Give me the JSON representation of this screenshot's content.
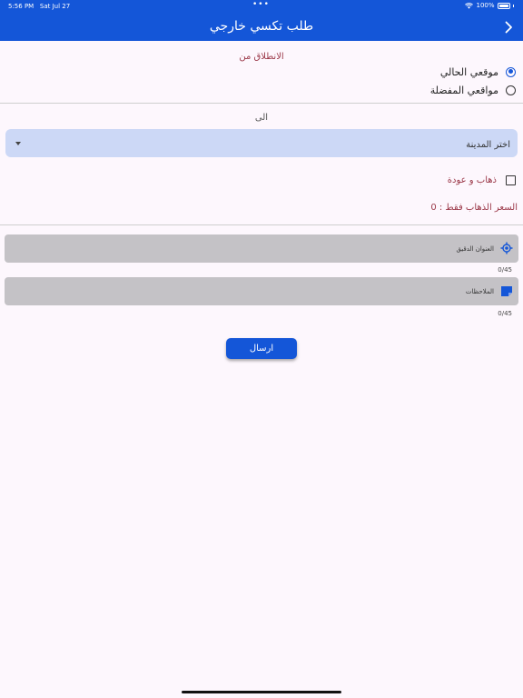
{
  "status_bar": {
    "time": "5:56 PM",
    "date": "Sat Jul 27",
    "battery": "100%"
  },
  "header": {
    "title": "طلب تكسي خارجي"
  },
  "from_section": {
    "label": "الانطلاق من",
    "options": [
      {
        "label": "موقعي الحالي",
        "selected": true
      },
      {
        "label": "مواقعي المفضلة",
        "selected": false
      }
    ]
  },
  "to_section": {
    "label": "الى",
    "city_select": {
      "value": "اختر المدينة"
    }
  },
  "round_trip": {
    "label": "ذهاب و عودة",
    "checked": false
  },
  "price": {
    "text": "السعر الذهاب فقط : 0"
  },
  "address_field": {
    "label": "العنوان الدقيق",
    "counter": "0/45",
    "icon": "location-target-icon"
  },
  "notes_field": {
    "label": "الملاحظات",
    "counter": "0/45",
    "icon": "note-icon"
  },
  "submit_button": {
    "label": "ارسال"
  },
  "colors": {
    "primary": "#1456d8",
    "accent_text": "#9c3a4a",
    "select_bg": "#ccd8f6",
    "field_bg": "#c4c2c6",
    "background": "#fdf7fd"
  }
}
